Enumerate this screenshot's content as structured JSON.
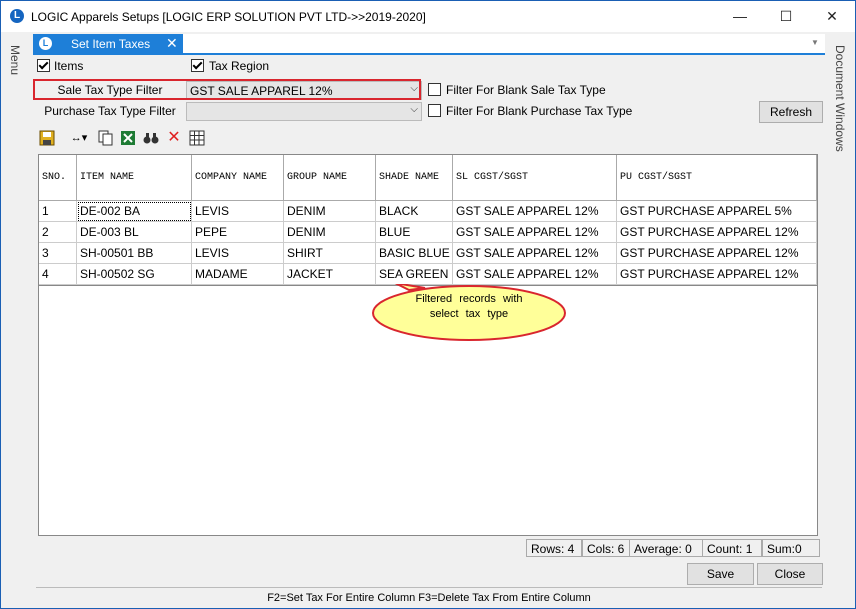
{
  "window": {
    "title": "LOGIC Apparels Setups  [LOGIC ERP SOLUTION PVT LTD->>2019-2020]",
    "app_icon": "L",
    "minimize": "—",
    "maximize": "☐",
    "close": "✕"
  },
  "side_panels": {
    "left": "Menu",
    "right": "Document Windows"
  },
  "tab": {
    "label": "Set Item Taxes",
    "icon": "L",
    "close": "✕"
  },
  "options": {
    "items_label": "Items",
    "items_checked": true,
    "tax_region_label": "Tax Region",
    "tax_region_checked": true
  },
  "filters": {
    "sale_label": "Sale Tax Type Filter",
    "sale_value": "GST SALE APPAREL 12%",
    "purchase_label": "Purchase Tax Type Filter",
    "purchase_value": "",
    "blank_sale_label": "Filter For Blank Sale Tax Type",
    "blank_purchase_label": "Filter For Blank Purchase Tax Type",
    "refresh_label": "Refresh"
  },
  "toolbar": [
    "save-icon",
    "column-width-icon",
    "copy-icon",
    "excel-icon",
    "find-icon",
    "delete-icon",
    "grid-icon"
  ],
  "grid": {
    "columns": [
      "SNO.",
      "ITEM NAME",
      "COMPANY NAME",
      "GROUP NAME",
      "SHADE NAME",
      "SL CGST/SGST",
      "PU CGST/SGST"
    ],
    "rows": [
      [
        "1",
        "DE-002 BA",
        "LEVIS",
        "DENIM",
        "BLACK",
        "GST SALE APPAREL 12%",
        "GST PURCHASE APPAREL 5%"
      ],
      [
        "2",
        "DE-003 BL",
        "PEPE",
        "DENIM",
        "BLUE",
        "GST SALE APPAREL 12%",
        "GST PURCHASE APPAREL 12%"
      ],
      [
        "3",
        "SH-00501 BB",
        "LEVIS",
        "SHIRT",
        "BASIC BLUE",
        "GST SALE APPAREL 12%",
        "GST PURCHASE APPAREL 12%"
      ],
      [
        "4",
        "SH-00502 SG",
        "MADAME",
        "JACKET",
        "SEA GREEN",
        "GST SALE APPAREL 12%",
        "GST PURCHASE APPAREL 12%"
      ]
    ]
  },
  "callout": {
    "text": "Filtered records with select tax type"
  },
  "status": {
    "rows": "Rows: 4",
    "cols": "Cols: 6",
    "average": "Average: 0",
    "count": "Count: 1",
    "sum": "Sum:0"
  },
  "buttons": {
    "save": "Save",
    "close": "Close"
  },
  "hint": "F2=Set Tax For Entire Column  F3=Delete Tax From Entire Column",
  "colors": {
    "accent": "#1e7fd8",
    "highlight": "#d9262e",
    "callout_fill": "#ffff99",
    "callout_border": "#d9262e"
  }
}
